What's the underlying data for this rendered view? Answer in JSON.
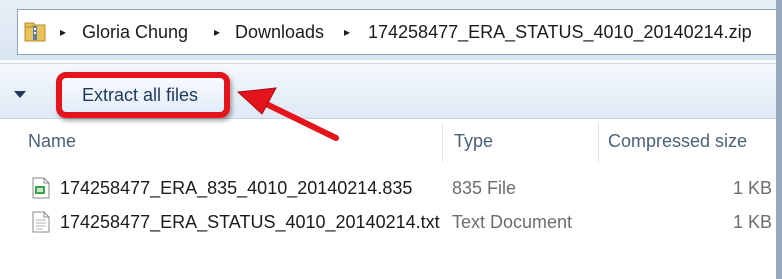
{
  "address_bar": {
    "breadcrumbs": [
      "Gloria Chung",
      "Downloads",
      "174258477_ERA_STATUS_4010_20140214.zip"
    ],
    "separator": "▸"
  },
  "toolbar": {
    "extract_label": "Extract all files"
  },
  "columns": {
    "name": "Name",
    "type": "Type",
    "compressed_size": "Compressed size"
  },
  "files": [
    {
      "name": "174258477_ERA_835_4010_20140214.835",
      "type": "835 File",
      "size": "1 KB",
      "icon": "generic-file-icon"
    },
    {
      "name": "174258477_ERA_STATUS_4010_20140214.txt",
      "type": "Text Document",
      "size": "1 KB",
      "icon": "text-file-icon"
    }
  ],
  "colors": {
    "highlight": "#e3141b",
    "toolbar": "#dfe9f5"
  }
}
